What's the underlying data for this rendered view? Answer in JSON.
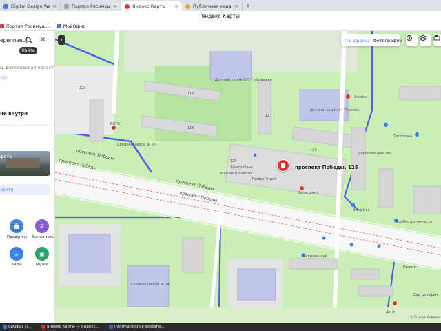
{
  "tabs": [
    {
      "title": "Digital Design Web Client",
      "color": "#3b7dd8"
    },
    {
      "title": "Портал Росимущества",
      "color": "#9aa0a6"
    },
    {
      "title": "Яндекс Карты",
      "color": "#e8312f",
      "active": true
    },
    {
      "title": "Публичная кадастровая",
      "color": "#f0a030"
    }
  ],
  "new_tab": "+",
  "tab_close": "×",
  "window_title": "Яндекс Карты",
  "bookmarks": [
    {
      "label": "Портал Росимущ...",
      "color": "#c43a3a"
    },
    {
      "label": "МойОфис",
      "color": "#3a7bd5"
    }
  ],
  "panel": {
    "search_value": "ереповец,",
    "find_label": "Найти",
    "region": "ц, Вологодская област",
    "more_dots": "...",
    "inside_heading": "ни внутри",
    "photo_label": "фото",
    "photo_button": "фото",
    "categories": [
      {
        "label": "Продукты",
        "color": "#3f7fe0",
        "glyph": "⬤"
      },
      {
        "label": "Банкоматы",
        "color": "#8a5ad2",
        "glyph": "₽"
      },
      {
        "label": "Кафе",
        "color": "#3f7fe0",
        "glyph": "☕"
      },
      {
        "label": "Музеи",
        "color": "#2aa26b",
        "glyph": "▣"
      }
    ]
  },
  "map": {
    "place_label": "проспект Победы, 125",
    "toggle": {
      "panoramas": "Панорамы",
      "photos": "Фотографии"
    },
    "collapse": "‹",
    "footer": "© Яндекс  Справка",
    "road_labels": [
      "проспект Победы",
      "проспект Победы",
      "проспект Победы",
      "проспект Победы"
    ],
    "labels": {
      "kindergarten_1": "Детский сад № 121 Гнёздышко",
      "kindergarten_2": "Детский сад № 24 Теремок",
      "school_1": "Средняя школа № 16",
      "school_2": "Средняя школа № 34",
      "vita": "ВИТА",
      "chereposetsky": "Чероповецкий лес",
      "pyaterochka": "Пятёрочка",
      "centrobank": "Центробанк",
      "magnit": "Магнит Косметик",
      "trade_story": "Трейдс-Строй",
      "vesti": "Велес дент",
      "sivelo": "Вилд Ива",
      "instrument": "ВсёИнструменты.ру",
      "cherepovez": "Черповецкий",
      "sad": "Сад дельфин",
      "pelzin": "Пеляти",
      "dent": "Дент",
      "ulibka": "Улыбка",
      "b123": "123",
      "b125": "125",
      "b115": "115",
      "b118": "118",
      "b127": "127",
      "b129": "129"
    }
  },
  "taskbar": [
    {
      "label": "ойОфис П...",
      "color": "#3a7bd5"
    },
    {
      "label": "Яндекс Карты — Яндекс...",
      "color": "#e8312f"
    },
    {
      "label": "Informacionnoe soobshe...",
      "color": "#2a64b8"
    }
  ]
}
